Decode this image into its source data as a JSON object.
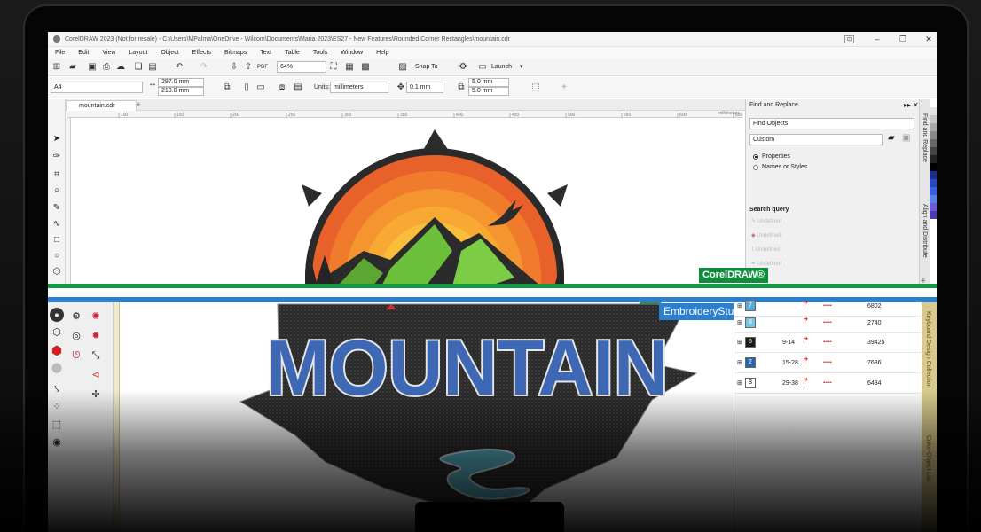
{
  "coreldraw": {
    "title": "CorelDRAW 2023 (Not for resale) - C:\\Users\\MPalma\\OneDrive - Wilcom\\Documents\\Maria 2023\\ES27 - New Features\\Rounded Corner Rectangles\\mountain.cdr",
    "menu": [
      "File",
      "Edit",
      "View",
      "Layout",
      "Object",
      "Effects",
      "Bitmaps",
      "Text",
      "Table",
      "Tools",
      "Window",
      "Help"
    ],
    "toolbar": {
      "zoom": "64%",
      "snap_to": "Snap To",
      "launch": "Launch"
    },
    "property_bar": {
      "page_size": "A4",
      "width": "297.0 mm",
      "height": "210.0 mm",
      "units_label": "Units:",
      "units": "millimeters",
      "nudge": "0.1 mm",
      "dup_x": "5.0 mm",
      "dup_y": "5.0 mm"
    },
    "doc_tab": "mountain.cdr",
    "ruler_unit": "millimeters",
    "ruler_ticks": [
      "100",
      "150",
      "200",
      "250",
      "300",
      "350",
      "400",
      "450",
      "500",
      "550",
      "600",
      "650"
    ],
    "find_panel": {
      "title": "Find and Replace",
      "mode": "Find Objects",
      "preset": "Custom",
      "options": [
        "Properties",
        "Names or Styles"
      ],
      "selected_option": "Properties",
      "search_query_label": "Search query",
      "query_items": [
        "Undefined",
        "Undefined",
        "Undefined",
        "Undefined"
      ]
    },
    "dock_tabs": [
      "Find and Replace",
      "Align and Distribute"
    ],
    "badge": "CorelDRAW®"
  },
  "embroidery": {
    "badge": "EmbroideryStudio",
    "design_text": "MOUNTAIN",
    "object_rows": [
      {
        "color_no": "7",
        "range": "",
        "stitches": "6802",
        "color": "#5aa9d8"
      },
      {
        "color_no": "8",
        "range": "",
        "stitches": "2740",
        "color": "#6ec6e8"
      },
      {
        "color_no": "6",
        "range": "9-14",
        "stitches": "39425",
        "color": "#1a1a1a"
      },
      {
        "color_no": "2",
        "range": "15-28",
        "stitches": "7686",
        "color": "#2a64b0"
      },
      {
        "color_no": "8",
        "range": "29-38",
        "stitches": "6434",
        "color": "#ffffff"
      }
    ],
    "side_tabs": [
      "Keyboard Design Collection",
      "Color-Object List"
    ]
  },
  "colors": {
    "corel_green": "#0e8c3c",
    "es_blue": "#2a7fd0"
  }
}
